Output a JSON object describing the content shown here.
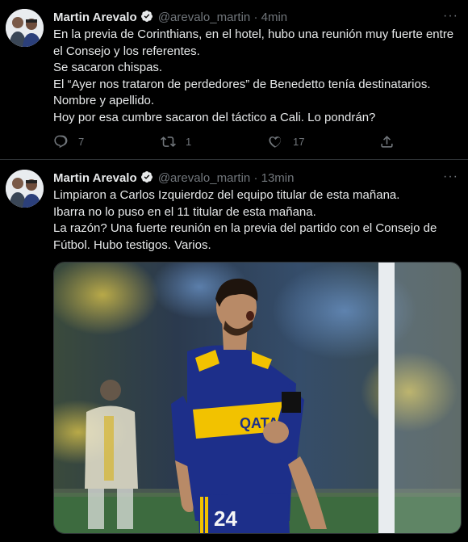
{
  "tweets": [
    {
      "author_name": "Martin Arevalo",
      "handle": "@arevalo_martin",
      "separator": "·",
      "time": "4min",
      "more_label": "···",
      "lines": [
        "En la previa de Corinthians, en el hotel, hubo una reunión muy fuerte entre",
        "el Consejo y los referentes.",
        "Se sacaron chispas.",
        "El “Ayer nos trataron de perdedores” de Benedetto tenía destinatarios.",
        "Nombre y apellido.",
        "Hoy por esa cumbre sacaron del táctico a Cali. Lo pondrán?"
      ],
      "replies": "7",
      "retweets": "1",
      "likes": "17"
    },
    {
      "author_name": "Martin Arevalo",
      "handle": "@arevalo_martin",
      "separator": "·",
      "time": "13min",
      "more_label": "···",
      "lines": [
        "Limpiaron a Carlos Izquierdoz del equipo titular de esta mañana.",
        "Ibarra no lo puso en el 11 titular de esta mañana.",
        "La razón? Una fuerte reunión en la previa del partido con el Consejo de",
        "Fútbol. Hubo testigos. Varios."
      ],
      "jersey_number": "24",
      "jersey_sponsor": "QATAR"
    }
  ],
  "colors": {
    "background": "#000000",
    "text": "#e7e9ea",
    "muted": "#71767b",
    "divider": "#2f3336",
    "jersey_blue": "#1d2f8a",
    "jersey_gold": "#f2c200"
  },
  "icons": [
    "verified-badge-icon",
    "more-icon",
    "reply-icon",
    "retweet-icon",
    "like-icon",
    "share-icon"
  ]
}
